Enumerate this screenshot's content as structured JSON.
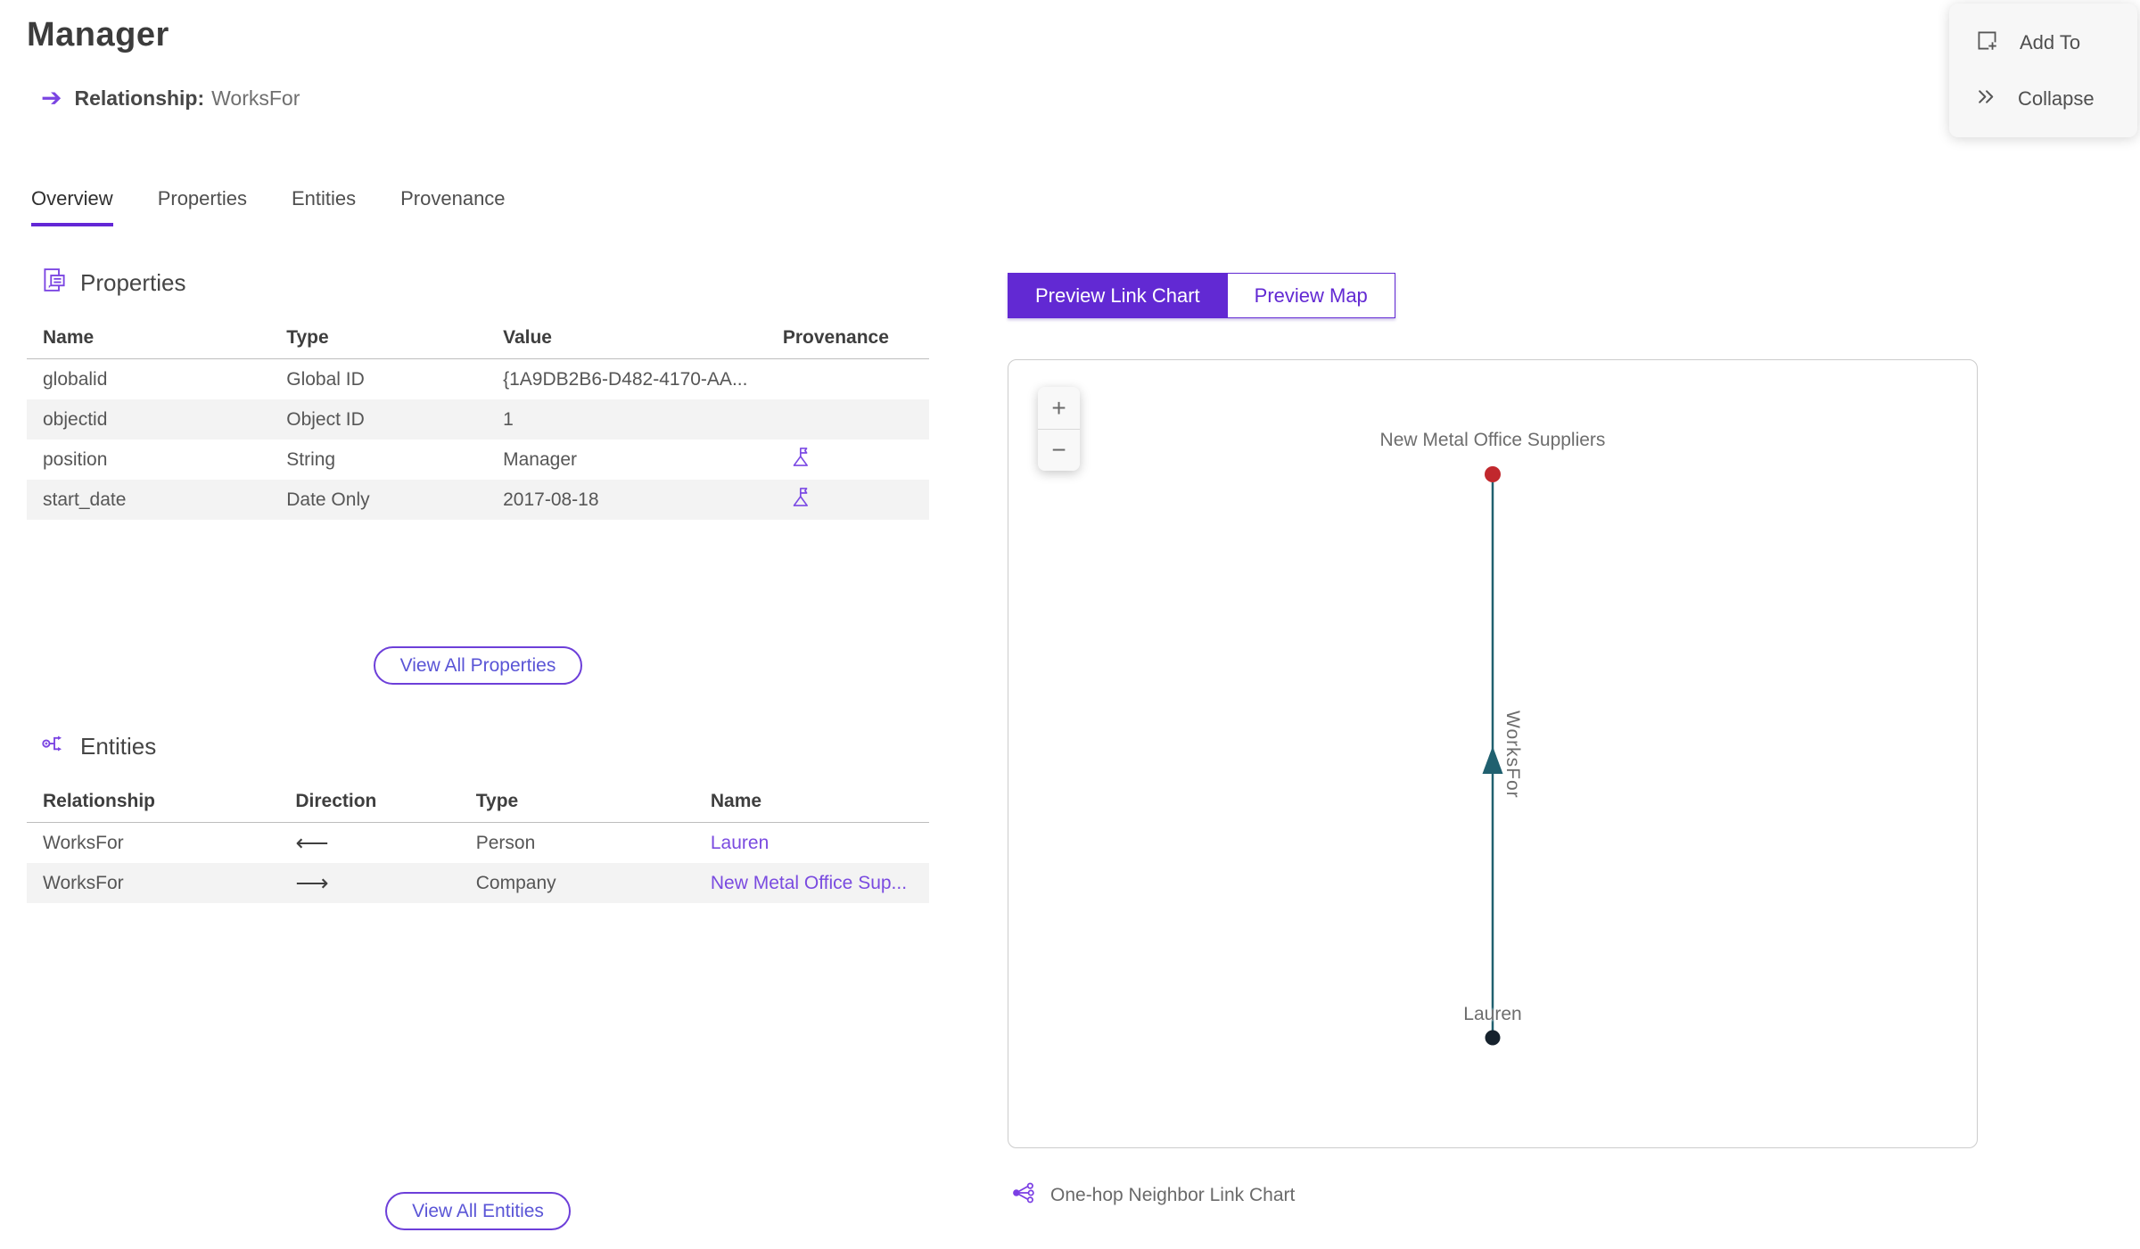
{
  "header": {
    "title": "Manager",
    "subtitle_label": "Relationship:",
    "subtitle_value": "WorksFor"
  },
  "actions": {
    "add_to": "Add To",
    "collapse": "Collapse"
  },
  "tabs": [
    {
      "label": "Overview",
      "active": true
    },
    {
      "label": "Properties",
      "active": false
    },
    {
      "label": "Entities",
      "active": false
    },
    {
      "label": "Provenance",
      "active": false
    }
  ],
  "properties_section": {
    "heading": "Properties",
    "columns": [
      "Name",
      "Type",
      "Value",
      "Provenance"
    ],
    "rows": [
      {
        "name": "globalid",
        "type": "Global ID",
        "value": "{1A9DB2B6-D482-4170-AA...",
        "has_provenance": false
      },
      {
        "name": "objectid",
        "type": "Object ID",
        "value": "1",
        "has_provenance": false
      },
      {
        "name": "position",
        "type": "String",
        "value": "Manager",
        "has_provenance": true
      },
      {
        "name": "start_date",
        "type": "Date Only",
        "value": "2017-08-18",
        "has_provenance": true
      }
    ],
    "view_all_label": "View All Properties"
  },
  "entities_section": {
    "heading": "Entities",
    "columns": [
      "Relationship",
      "Direction",
      "Type",
      "Name"
    ],
    "rows": [
      {
        "relationship": "WorksFor",
        "direction": "⟵",
        "type": "Person",
        "name": "Lauren"
      },
      {
        "relationship": "WorksFor",
        "direction": "⟶",
        "type": "Company",
        "name": "New Metal Office Sup..."
      }
    ],
    "view_all_label": "View All Entities"
  },
  "preview": {
    "link_chart_label": "Preview Link Chart",
    "map_label": "Preview Map",
    "zoom_in": "+",
    "zoom_out": "−",
    "footer_label": "One-hop Neighbor Link Chart"
  },
  "chart_data": {
    "type": "link-chart",
    "nodes": [
      {
        "label": "New Metal Office Suppliers",
        "entity_type": "Company",
        "color": "#c1282d"
      },
      {
        "label": "Lauren",
        "entity_type": "Person",
        "color": "#16222d"
      }
    ],
    "edges": [
      {
        "label": "WorksFor",
        "from": "Lauren",
        "to": "New Metal Office Suppliers",
        "color": "#20606f",
        "arrow": "up"
      }
    ]
  },
  "colors": {
    "accent_purple": "#6229d3",
    "icon_purple": "#7b45e2",
    "link_purple": "#7a4be0",
    "node_red": "#c1282d",
    "edge_teal": "#20606f",
    "node_dark": "#16222d",
    "row_alt_gray": "#f3f3f3"
  }
}
